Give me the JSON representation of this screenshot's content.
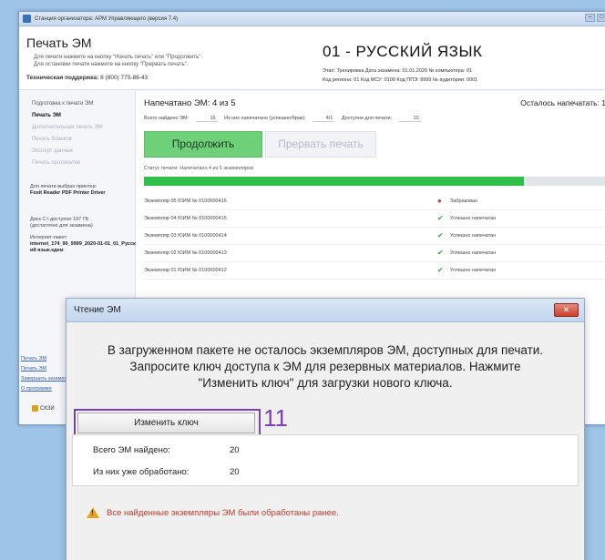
{
  "window": {
    "title": "Станция организатора: АРМ Управляющего (версия 7.4)",
    "app_title": "Печать ЭМ",
    "hint_line1": "Для печати нажмите на кнопку \"Начать печать\" или \"Продолжить\".",
    "hint_line2": "Для остановки печати нажмите на кнопку \"Прервать печать\".",
    "support_label": "Техническая поддержка:",
    "support_phone": "8 (800) 775-88-43",
    "minimize": "–",
    "maximize": "□",
    "close": "×"
  },
  "exam": {
    "subject": "01 - РУССКИЙ ЯЗЫК",
    "meta_line1": "Этап: Тренировка   Дата экзамена: 01.01.2020   № компьютера: 01",
    "meta_line2": "Код региона: 01   Код МСУ: 0100   Код ППЭ: 9999   № аудитории: 0001"
  },
  "sidebar": {
    "items": [
      {
        "label": "Подготовка к печати ЭМ",
        "state": "normal"
      },
      {
        "label": "Печать ЭМ",
        "state": "active"
      },
      {
        "label": "Дополнительная печать ЭМ",
        "state": "disabled"
      },
      {
        "label": "Печать бланков",
        "state": "disabled"
      },
      {
        "label": "Экспорт данных",
        "state": "disabled"
      },
      {
        "label": "Печать протоколов",
        "state": "disabled"
      }
    ],
    "printer_note_label": "Для печати выбран принтер:",
    "printer_name": "Foxit Reader PDF Printer Driver",
    "disk_note_label": "Диск C:\\ доступно 197 ГБ",
    "disk_note_sub": "(достаточно для экзамена)",
    "package_label": "Интернет-пакет:",
    "package_name": "internet_174_90_9999_2020-01-01_01_Русский язык.кдем",
    "links": [
      "Печать ЭМ",
      "Печать ЭМ",
      "Завершить экзамен",
      "О программе"
    ],
    "skzi": "СКЗИ"
  },
  "content": {
    "printed_label": "Напечатано ЭМ:",
    "printed_value": "4 из 5",
    "remaining_label": "Осталось напечатать: 1",
    "stats": {
      "found_label": "Всего найдено ЭМ:",
      "found_value": "15",
      "printed_ok_label": "Из них напечатано (успешно/брак):",
      "printed_ok_value": "4/1",
      "available_label": "Доступно для печати:",
      "available_value": "10"
    },
    "continue_label": "Продолжить",
    "abort_label": "Прервать печать",
    "print_status": "Статус печати:   Напечатано 4 из 5 экземпляров",
    "progress": 0.8,
    "copies": [
      {
        "name": "Экземпляр 05  ЮИМ № 0100000416",
        "status": "Забракован",
        "ok": false
      },
      {
        "name": "Экземпляр 04  ЮИМ № 0100000415",
        "status": "Успешно напечатан",
        "ok": true
      },
      {
        "name": "Экземпляр 03  ЮИМ № 0100000414",
        "status": "Успешно напечатан",
        "ok": true
      },
      {
        "name": "Экземпляр 02  ЮИМ № 0100000413",
        "status": "Успешно напечатан",
        "ok": true
      },
      {
        "name": "Экземпляр 01  ЮИМ № 0100000412",
        "status": "Успешно напечатан",
        "ok": true
      }
    ]
  },
  "dialog": {
    "title": "Чтение ЭМ",
    "close_label": "✕",
    "message_line1": "В загруженном пакете не осталось экземпляров ЭМ, доступных для печати.",
    "message_line2": "Запросите ключ доступа к ЭМ для резервных материалов. Нажмите",
    "message_line3": "\"Изменить ключ\" для загрузки нового ключа.",
    "change_key_label": "Изменить ключ",
    "annotation_number": "11",
    "total_found_label": "Всего ЭМ найдено:",
    "total_found_value": "20",
    "processed_label": "Из них уже обработано:",
    "processed_value": "20",
    "warning": "Все найденные экземпляры ЭМ были обработаны ранее."
  },
  "colors": {
    "accent_green": "#2fbf4a",
    "continue_button": "#6fd07a",
    "annotation_purple": "#7b3fb5",
    "warning_red": "#c0392b"
  }
}
